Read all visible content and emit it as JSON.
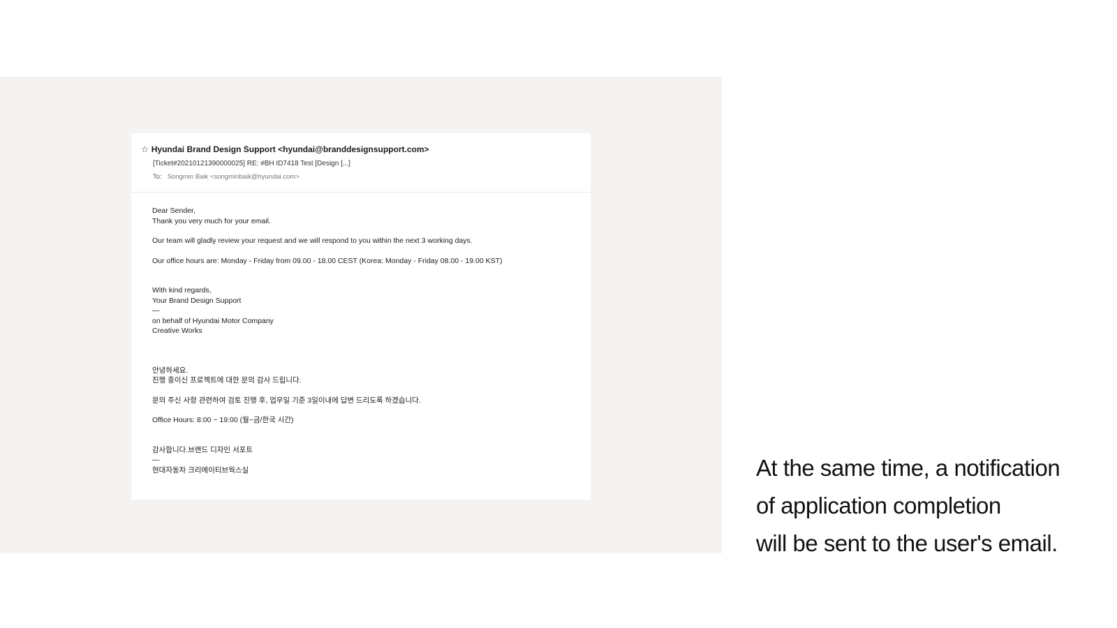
{
  "email": {
    "star_icon": "☆",
    "from": "Hyundai Brand Design Support <hyundai@branddesignsupport.com>",
    "subject": "[Ticket#20210121390000025] RE: #BH ID7418 Test [Design  [...]",
    "to_label": "To:",
    "to_value": "Songmin Baik <songminbaik@hyundai.com>",
    "body": {
      "greeting": "Dear Sender,",
      "thanks": "Thank you very much for your email.",
      "review": "Our team will gladly review your request and we will respond to you within the next 3 working days.",
      "hours": "Our office hours are: Monday - Friday from 09.00 - 18.00 CEST (Korea: Monday - Friday 08.00 - 19.00 KST)",
      "regards": "With kind regards,",
      "team": "Your Brand Design Support",
      "separator_1": "—",
      "behalf": "on behalf of Hyundai Motor Company",
      "works": "Creative Works",
      "kr_greeting": "안녕하세요.",
      "kr_thanks": "진행 중이신 프로젝트에 대한 문의 감사 드립니다.",
      "kr_review": "문의 주신 사항 관련하여 검토 진행 후, 업무일 기준 3일이내에 답변 드리도록 하겠습니다.",
      "kr_hours": "Office Hours: 8:00 ~ 19:00 (월~금/한국 시간)",
      "kr_closing": "감사합니다.브랜드 디자인 서포트",
      "separator_2": "—",
      "kr_company": "현대자동차 크리에이티브웍스실"
    }
  },
  "caption": {
    "line1": "At the same time, a notification",
    "line2": "of application completion",
    "line3": "will be sent to the user's email."
  }
}
